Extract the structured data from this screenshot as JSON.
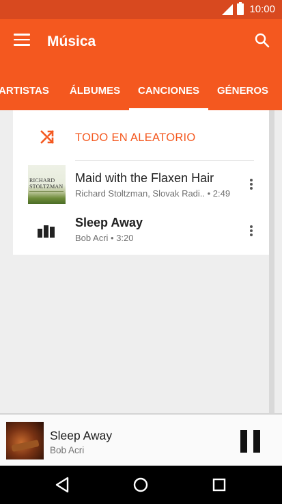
{
  "status_bar": {
    "time": "10:00"
  },
  "app_bar": {
    "title": "Música"
  },
  "tabs": [
    {
      "label": "ARTISTAS",
      "selected": false
    },
    {
      "label": "ÁLBUMES",
      "selected": false
    },
    {
      "label": "CANCIONES",
      "selected": true
    },
    {
      "label": "GÉNEROS",
      "selected": false
    }
  ],
  "shuffle": {
    "label": "TODO EN ALEATORIO",
    "icon": "shuffle-icon"
  },
  "songs": [
    {
      "title": "Maid with the Flaxen Hair",
      "subtitle": "Richard Stoltzman, Slovak Radi.. • 2:49",
      "art_text": [
        "RICHARD",
        "STOLTZMAN"
      ],
      "playing": false
    },
    {
      "title": "Sleep Away",
      "subtitle": "Bob Acri • 3:20",
      "playing": true
    }
  ],
  "now_playing": {
    "title": "Sleep Away",
    "artist": "Bob Acri"
  },
  "colors": {
    "accent": "#f4581f",
    "status_bar": "#d8491f",
    "text_primary": "#212121",
    "text_secondary": "#707070"
  }
}
